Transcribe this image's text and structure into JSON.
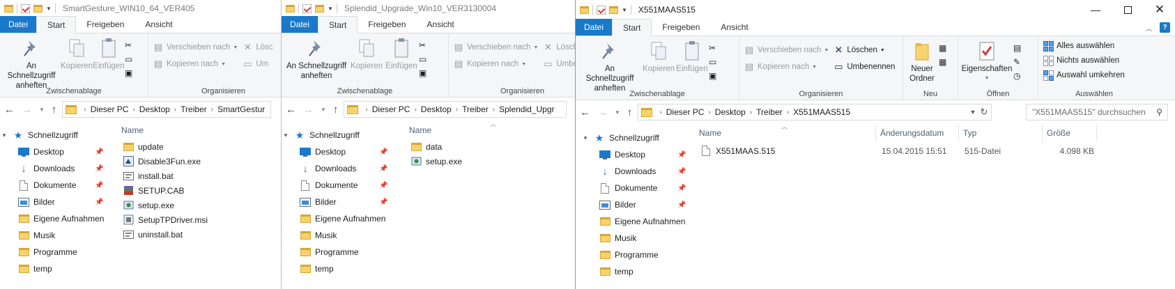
{
  "windows": [
    {
      "title": "SmartGesture_WIN10_64_VER405",
      "tabs": [
        "Datei",
        "Start",
        "Freigeben",
        "Ansicht"
      ],
      "ribbon": {
        "clipboard": {
          "pin_label": "An Schnellzugriff anheften",
          "copy": "Kopieren",
          "paste": "Einfügen",
          "group": "Zwischenablage"
        },
        "organize": {
          "move": "Verschieben nach",
          "copy_to": "Kopieren nach",
          "delete": "Lösc",
          "rename": "Um",
          "group": "Organisieren"
        }
      },
      "path": [
        "Dieser PC",
        "Desktop",
        "Treiber",
        "SmartGestur"
      ],
      "tree": [
        "Schnellzugriff",
        "Desktop",
        "Downloads",
        "Dokumente",
        "Bilder",
        "Eigene Aufnahmen",
        "Musik",
        "Programme",
        "temp"
      ],
      "columns": {
        "name": "Name"
      },
      "files": [
        "update",
        "Disable3Fun.exe",
        "install.bat",
        "SETUP.CAB",
        "setup.exe",
        "SetupTPDriver.msi",
        "uninstall.bat"
      ]
    },
    {
      "title": "Splendid_Upgrade_Win10_VER3130004",
      "tabs": [
        "Datei",
        "Start",
        "Freigeben",
        "Ansicht"
      ],
      "ribbon": {
        "clipboard": {
          "pin_label": "An Schnellzugriff anheften",
          "copy": "Kopieren",
          "paste": "Einfügen",
          "group": "Zwischenablage"
        },
        "organize": {
          "move": "Verschieben nach",
          "copy_to": "Kopieren nach",
          "delete": "Lösch",
          "rename": "Umbe",
          "group": "Organisieren"
        }
      },
      "path": [
        "Dieser PC",
        "Desktop",
        "Treiber",
        "Splendid_Upgr"
      ],
      "tree": [
        "Schnellzugriff",
        "Desktop",
        "Downloads",
        "Dokumente",
        "Bilder",
        "Eigene Aufnahmen",
        "Musik",
        "Programme",
        "temp"
      ],
      "columns": {
        "name": "Name"
      },
      "files": [
        "data",
        "setup.exe"
      ]
    },
    {
      "title": "X551MAAS515",
      "tabs": [
        "Datei",
        "Start",
        "Freigeben",
        "Ansicht"
      ],
      "ribbon": {
        "clipboard": {
          "pin_label": "An Schnellzugriff anheften",
          "copy": "Kopieren",
          "paste": "Einfügen",
          "group": "Zwischenablage"
        },
        "organize": {
          "move": "Verschieben nach",
          "copy_to": "Kopieren nach",
          "delete": "Löschen",
          "rename": "Umbenennen",
          "group": "Organisieren"
        },
        "new": {
          "new_folder": "Neuer Ordner",
          "group": "Neu"
        },
        "open": {
          "properties": "Eigenschaften",
          "group": "Öffnen"
        },
        "select": {
          "all": "Alles auswählen",
          "none": "Nichts auswählen",
          "invert": "Auswahl umkehren",
          "group": "Auswählen"
        }
      },
      "path": [
        "Dieser PC",
        "Desktop",
        "Treiber",
        "X551MAAS515"
      ],
      "search_placeholder": "\"X551MAAS515\" durchsuchen",
      "tree": [
        "Schnellzugriff",
        "Desktop",
        "Downloads",
        "Dokumente",
        "Bilder",
        "Eigene Aufnahmen",
        "Musik",
        "Programme",
        "temp"
      ],
      "columns": {
        "name": "Name",
        "date": "Änderungsdatum",
        "type": "Typ",
        "size": "Größe"
      },
      "file": {
        "name": "X551MAAS.515",
        "date": "15.04.2015 15:51",
        "type": "515-Datei",
        "size": "4.098 KB"
      }
    }
  ]
}
